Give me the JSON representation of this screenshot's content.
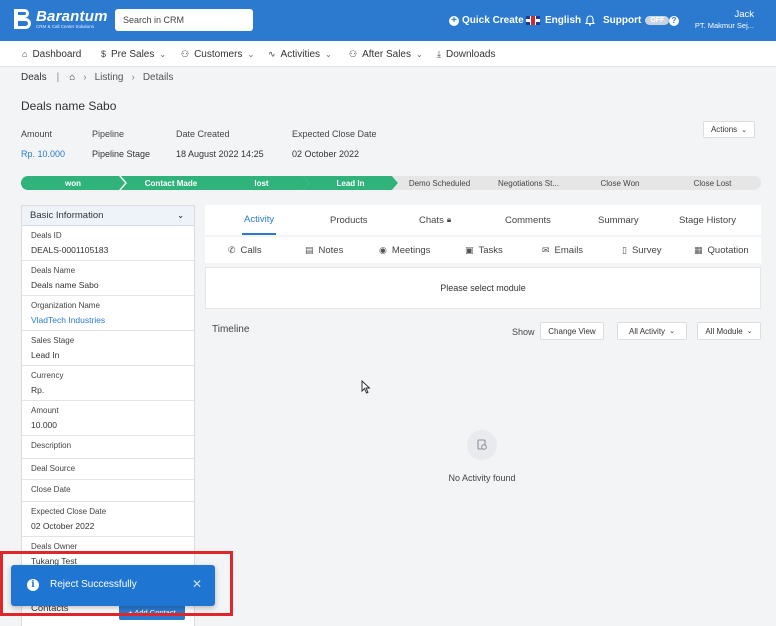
{
  "app": {
    "logo_name": "Barantum",
    "logo_sub": "CRM & Call Center Solutions",
    "search_placeholder": "Search in CRM",
    "quick_create": "Quick Create",
    "language": "English",
    "support": "Support",
    "support_toggle": "OFF",
    "user_name": "Jack",
    "user_company": "PT. Makmur Sej...",
    "brand_color": "#2b7ad0"
  },
  "menu": [
    {
      "label": "Dashboard",
      "icon": "home-icon",
      "has_chevron": false
    },
    {
      "label": "Pre Sales",
      "icon": "dollar-icon",
      "has_chevron": true
    },
    {
      "label": "Customers",
      "icon": "users-icon",
      "has_chevron": true
    },
    {
      "label": "Activities",
      "icon": "pulse-icon",
      "has_chevron": true
    },
    {
      "label": "After Sales",
      "icon": "users-icon",
      "has_chevron": true
    },
    {
      "label": "Downloads",
      "icon": "download-icon",
      "has_chevron": false
    }
  ],
  "breadcrumb": {
    "module": "Deals",
    "listing": "Listing",
    "details": "Details"
  },
  "page_title": "Deals name Sabo",
  "summary": {
    "amount_label": "Amount",
    "amount_value": "Rp. 10.000",
    "pipeline_label": "Pipeline",
    "pipeline_value": "Pipeline Stage",
    "date_created_label": "Date Created",
    "date_created_value": "18 August 2022 14:25",
    "expected_close_label": "Expected Close Date",
    "expected_close_value": "02 October 2022",
    "actions_label": "Actions"
  },
  "stages": [
    {
      "label": "won",
      "done": true
    },
    {
      "label": "Contact Made",
      "done": true
    },
    {
      "label": "lost",
      "done": true
    },
    {
      "label": "Lead In",
      "done": true
    },
    {
      "label": "Demo Scheduled",
      "done": false
    },
    {
      "label": "Negotiations St...",
      "done": false
    },
    {
      "label": "Close Won",
      "done": false
    },
    {
      "label": "Close Lost",
      "done": false
    }
  ],
  "basic_info": {
    "title": "Basic Information",
    "fields": [
      {
        "label": "Deals ID",
        "value": "DEALS-0001105183"
      },
      {
        "label": "Deals Name",
        "value": "Deals name Sabo"
      },
      {
        "label": "Organization Name",
        "value": "VladTech Industries"
      },
      {
        "label": "Sales Stage",
        "value": "Lead In"
      },
      {
        "label": "Currency",
        "value": "Rp."
      },
      {
        "label": "Amount",
        "value": "10.000"
      },
      {
        "label": "Description",
        "value": ""
      },
      {
        "label": "Deal Source",
        "value": ""
      },
      {
        "label": "Close Date",
        "value": ""
      },
      {
        "label": "Expected Close Date",
        "value": "02 October 2022"
      },
      {
        "label": "Deals Owner",
        "value": "Tukang Test"
      }
    ]
  },
  "tabs": [
    {
      "label": "Activity"
    },
    {
      "label": "Products"
    },
    {
      "label": "Chats"
    },
    {
      "label": "Comments"
    },
    {
      "label": "Summary"
    },
    {
      "label": "Stage History"
    }
  ],
  "modules": [
    {
      "label": "Calls",
      "icon": "phone-icon"
    },
    {
      "label": "Notes",
      "icon": "notes-icon"
    },
    {
      "label": "Meetings",
      "icon": "location-pin-icon"
    },
    {
      "label": "Tasks",
      "icon": "briefcase-icon"
    },
    {
      "label": "Emails",
      "icon": "envelope-icon"
    },
    {
      "label": "Survey",
      "icon": "document-icon"
    },
    {
      "label": "Quotation",
      "icon": "quotation-icon"
    }
  ],
  "select_module_text": "Please select module",
  "timeline": {
    "title": "Timeline",
    "show_label": "Show",
    "change_view": "Change View",
    "all_activity": "All Activity",
    "all_module": "All Module",
    "empty_text": "No Activity found"
  },
  "contacts": {
    "label": "Contacts",
    "add_button": "+ Add Contact"
  },
  "toast": {
    "message": "Reject Successfully",
    "color": "#1f76d2"
  }
}
